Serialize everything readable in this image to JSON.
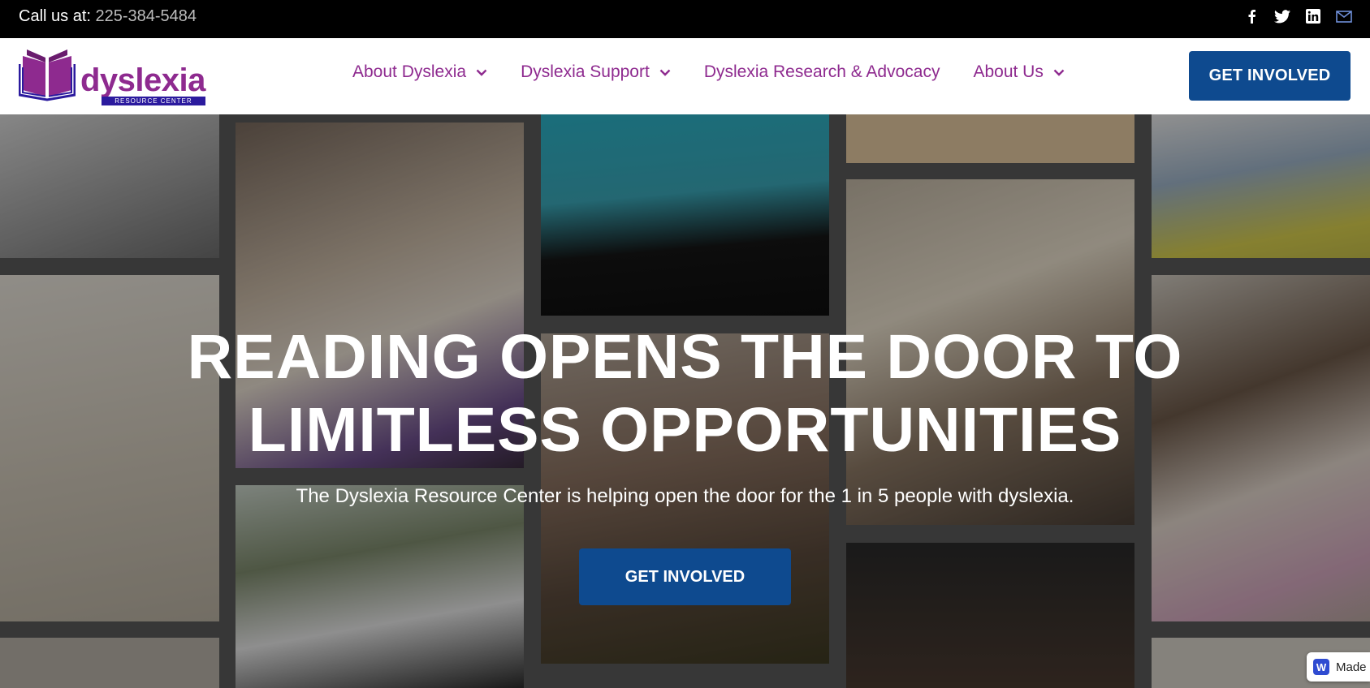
{
  "topbar": {
    "call_label": "Call us at:",
    "phone": "225-384-5484",
    "socials": [
      "facebook-icon",
      "twitter-icon",
      "linkedin-icon",
      "mail-icon"
    ]
  },
  "logo": {
    "word": "dyslexia",
    "tagline": "RESOURCE CENTER",
    "color": "#8e2a8f",
    "accent": "#2b1a9e"
  },
  "nav": {
    "items": [
      {
        "label": "About Dyslexia",
        "has_dropdown": true
      },
      {
        "label": "Dyslexia Support",
        "has_dropdown": true
      },
      {
        "label": "Dyslexia Research & Advocacy",
        "has_dropdown": false
      },
      {
        "label": "About Us",
        "has_dropdown": true
      }
    ],
    "cta_label": "GET INVOLVED"
  },
  "hero": {
    "title_line1": "READING OPENS THE DOOR TO",
    "title_line2": "LIMITLESS OPPORTUNITIES",
    "subtitle": "The Dyslexia Resource Center is helping open the door for the 1 in 5 people with dyslexia.",
    "cta_label": "GET INVOLVED"
  },
  "badge": {
    "letter": "W",
    "label": "Made"
  },
  "colors": {
    "brand_purple": "#8e2a8f",
    "button_blue": "#0e4a8f",
    "topbar_bg": "#000000"
  }
}
